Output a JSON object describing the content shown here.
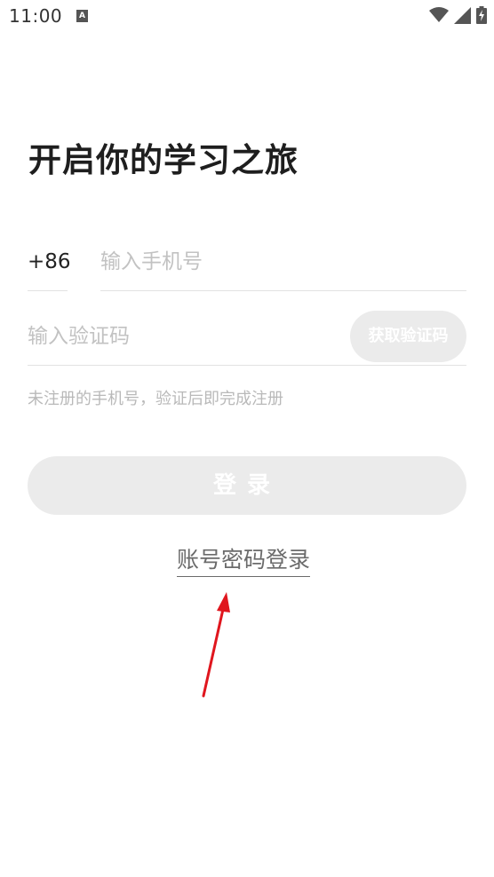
{
  "status_bar": {
    "time": "11:00",
    "notification_badge": "A",
    "icons": [
      "wifi-icon",
      "signal-icon",
      "battery-charging-icon"
    ]
  },
  "page": {
    "title": "开启你的学习之旅"
  },
  "phone": {
    "country_code": "+86",
    "placeholder": "输入手机号"
  },
  "verification": {
    "placeholder": "输入验证码",
    "get_code_label": "获取验证码"
  },
  "hint": "未注册的手机号，验证后即完成注册",
  "login_button_label": "登录",
  "password_login_label": "账号密码登录",
  "colors": {
    "accent_annotation": "#e0161e",
    "disabled_button_bg": "#ebebeb",
    "placeholder": "#c2c2c2"
  }
}
